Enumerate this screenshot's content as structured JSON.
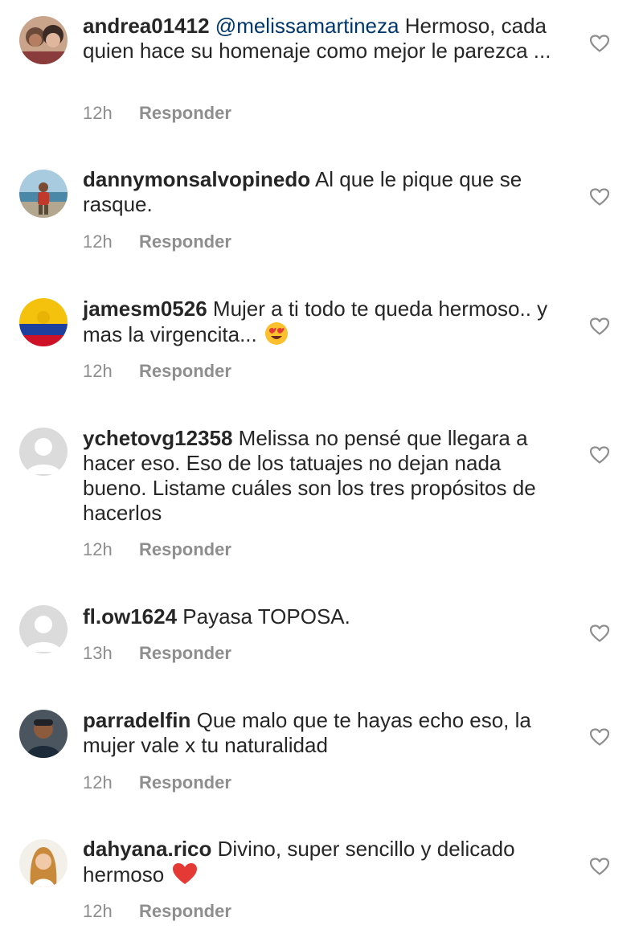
{
  "reply_label": "Responder",
  "comments": [
    {
      "username": "andrea01412",
      "mention": "@melissamartineza",
      "text": " Hermoso, cada quien hace su homenaje como mejor le parezca ...",
      "time": "12h",
      "avatar": "couple-photo"
    },
    {
      "username": "dannymonsalvopinedo",
      "text": " Al que le pique que se rasque.",
      "time": "12h",
      "avatar": "person-by-sea-photo"
    },
    {
      "username": "jamesm0526",
      "text": " Mujer a ti todo te queda hermoso.. y mas la virgencita... ",
      "time": "12h",
      "avatar": "colombia-flag",
      "emoji": "heart-eyes-emoji"
    },
    {
      "username": "ychetovg12358",
      "text": " Melissa no pensé que llegara a hacer eso. Eso de los tatuajes no dejan nada bueno. Listame cuáles son los tres propósitos de hacerlos",
      "time": "12h",
      "avatar": "default-profile"
    },
    {
      "username": "fl.ow1624",
      "text": " Payasa TOPOSA.",
      "time": "13h",
      "avatar": "default-profile"
    },
    {
      "username": "parradelfin",
      "text": " Que malo que te hayas echo eso, la mujer vale x tu naturalidad",
      "time": "12h",
      "avatar": "man-portrait-photo"
    },
    {
      "username": "dahyana.rico",
      "text": " Divino, super sencillo y delicado hermoso ",
      "time": "12h",
      "avatar": "woman-portrait-photo",
      "emoji": "red-heart-emoji"
    }
  ],
  "colors": {
    "text": "#262626",
    "secondary": "#8e8e8e",
    "mention": "#00376b",
    "background": "#ffffff"
  }
}
